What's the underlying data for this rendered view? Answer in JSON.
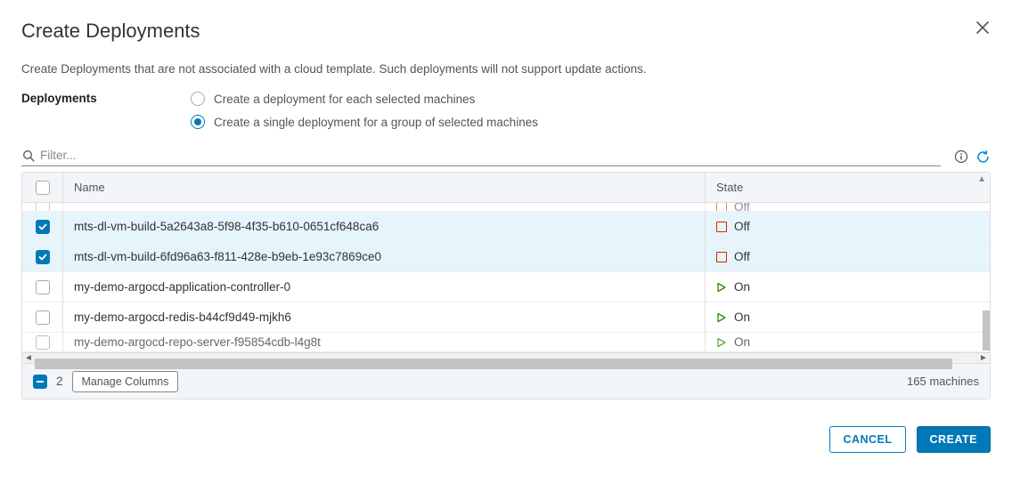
{
  "modal": {
    "title": "Create Deployments",
    "subtitle": "Create Deployments that are not associated with a cloud template. Such deployments will not support update actions.",
    "close": "Close"
  },
  "options": {
    "label": "Deployments",
    "opt1": "Create a deployment for each selected machines",
    "opt2": "Create a single deployment for a group of selected machines",
    "selected": 1
  },
  "filter": {
    "placeholder": "Filter..."
  },
  "columns": {
    "name": "Name",
    "state": "State"
  },
  "rows": [
    {
      "selected": false,
      "name": "",
      "state": "Off",
      "icon": "off",
      "partial": "top"
    },
    {
      "selected": true,
      "name": "mts-dl-vm-build-5a2643a8-5f98-4f35-b610-0651cf648ca6",
      "state": "Off",
      "icon": "off"
    },
    {
      "selected": true,
      "name": "mts-dl-vm-build-6fd96a63-f811-428e-b9eb-1e93c7869ce0",
      "state": "Off",
      "icon": "off"
    },
    {
      "selected": false,
      "name": "my-demo-argocd-application-controller-0",
      "state": "On",
      "icon": "on"
    },
    {
      "selected": false,
      "name": "my-demo-argocd-redis-b44cf9d49-mjkh6",
      "state": "On",
      "icon": "on"
    },
    {
      "selected": false,
      "name": "my-demo-argocd-repo-server-f95854cdb-l4g8t",
      "state": "On",
      "icon": "on",
      "partial": "bottom"
    }
  ],
  "footer": {
    "selected_count": "2",
    "manage_columns": "Manage Columns",
    "machines_count": "165 machines",
    "cancel": "CANCEL",
    "create": "CREATE"
  }
}
